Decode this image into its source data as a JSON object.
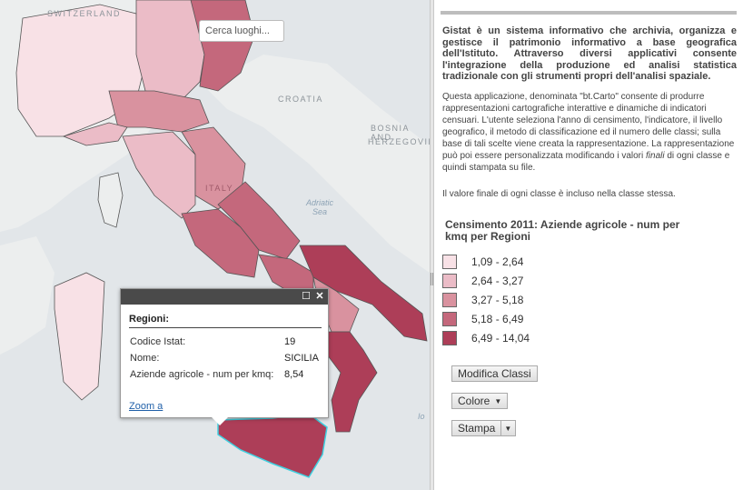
{
  "map": {
    "search_placeholder": "Cerca luoghi...",
    "labels": {
      "switzerland": "SWITZERLAND",
      "croatia": "CROATIA",
      "bosnia_line1": "BOSNIA AND",
      "bosnia_line2": "HERZEGOVINA",
      "italy": "ITALY",
      "adriatic_line1": "Adriatic",
      "adriatic_line2": "Sea",
      "ionian": "Io"
    },
    "popup": {
      "title": "Regioni:",
      "rows": [
        {
          "label": "Codice Istat:",
          "value": "19"
        },
        {
          "label": "Nome:",
          "value": "SICILIA"
        },
        {
          "label": "Aziende agricole - num per kmq:",
          "value": "8,54"
        }
      ],
      "zoom_link": "Zoom a"
    }
  },
  "panel": {
    "intro": "Gistat è un sistema informativo che archivia, organizza e gestisce il patrimonio informativo a base geografica dell'Istituto. Attraverso diversi applicativi consente l'integrazione della produzione ed analisi statistica tradizionale con gli strumenti propri dell'analisi spaziale.",
    "description_pre": "Questa applicazione, denominata \"bt.Carto\" consente di produrre rappresentazioni cartografiche interattive e dinamiche di indicatori censuari. L'utente seleziona l'anno di censimento, l'indicatore, il livello geografico, il metodo di classificazione ed il numero delle classi; sulla base di tali scelte viene creata la rappresentazione. La rappresentazione può poi essere personalizzata modificando i valori ",
    "description_em": "finali",
    "description_post": " di ogni classe e quindi stampata su file.",
    "final_note": "Il valore finale di ogni classe è incluso nella classe stessa.",
    "legend": {
      "title": "Censimento 2011: Aziende agricole - num per kmq per Regioni",
      "classes": [
        {
          "label": "1,09 - 2,64",
          "color": "#f8e1e6"
        },
        {
          "label": "2,64 - 3,27",
          "color": "#ebbcc7"
        },
        {
          "label": "3,27 - 5,18",
          "color": "#d9929f"
        },
        {
          "label": "5,18 - 6,49",
          "color": "#c4687c"
        },
        {
          "label": "6,49 - 14,04",
          "color": "#ad3e58"
        }
      ]
    },
    "buttons": {
      "modifica": "Modifica Classi",
      "colore": "Colore",
      "stampa": "Stampa"
    }
  }
}
